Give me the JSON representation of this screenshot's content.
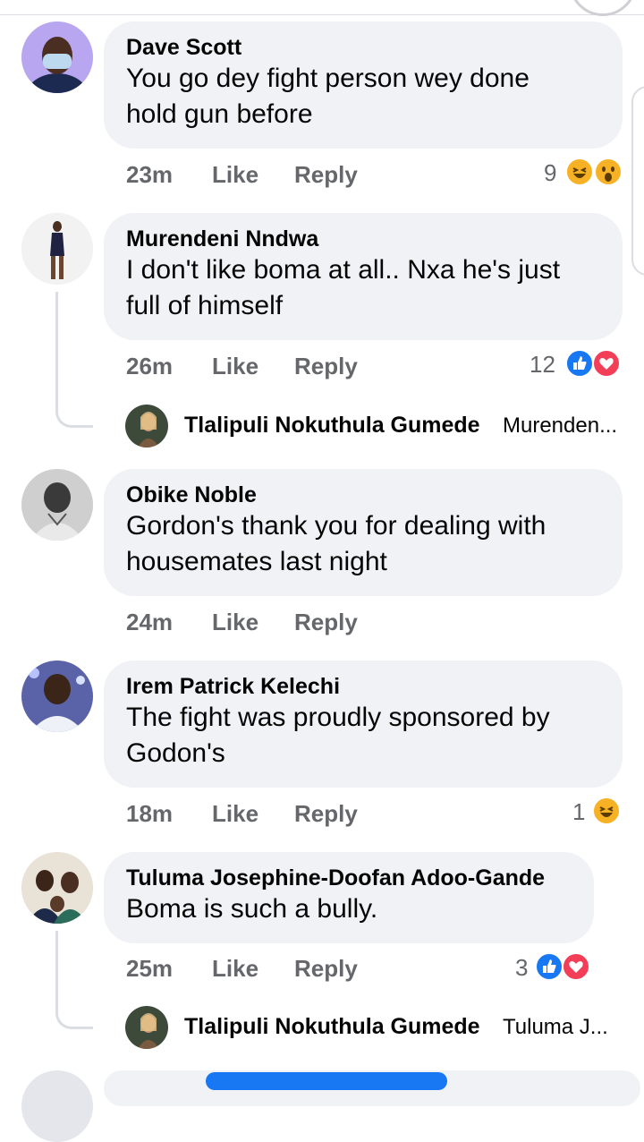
{
  "comments": [
    {
      "name": "Dave Scott",
      "text": "You go dey fight person wey done\nhold gun before",
      "time": "23m",
      "like": "Like",
      "reply": "Reply",
      "reaction_count": "9",
      "reaction_icons": [
        "laugh-icon",
        "wow-icon"
      ]
    },
    {
      "name": "Murendeni Nndwa",
      "text": "I don't like boma at all.. Nxa he's just\nfull of himself",
      "time": "26m",
      "like": "Like",
      "reply": "Reply",
      "reaction_count": "12",
      "reaction_icons": [
        "like-icon",
        "love-icon"
      ],
      "reply_preview": {
        "name": "Tlalipuli Nokuthula Gumede",
        "text": "Murenden..."
      }
    },
    {
      "name": "Obike Noble",
      "text": "Gordon's thank you for dealing with\nhousemates last night",
      "time": "24m",
      "like": "Like",
      "reply": "Reply"
    },
    {
      "name": "Irem Patrick Kelechi",
      "text": "The fight was proudly sponsored by\nGodon's",
      "time": "18m",
      "like": "Like",
      "reply": "Reply",
      "reaction_count": "1",
      "reaction_icons": [
        "laugh-icon"
      ]
    },
    {
      "name": "Tuluma Josephine-Doofan Adoo-Gande",
      "text": "Boma is such a bully.",
      "time": "25m",
      "like": "Like",
      "reply": "Reply",
      "reaction_count": "3",
      "reaction_icons": [
        "like-icon",
        "love-icon"
      ],
      "reply_preview": {
        "name": "Tlalipuli Nokuthula Gumede",
        "text": "Tuluma J..."
      }
    }
  ],
  "colors": {
    "bubble": "#f0f2f5",
    "meta_text": "#65676b",
    "like_blue": "#1877f2",
    "love_red": "#f33e58",
    "haha_yellow": "#f7b125"
  }
}
